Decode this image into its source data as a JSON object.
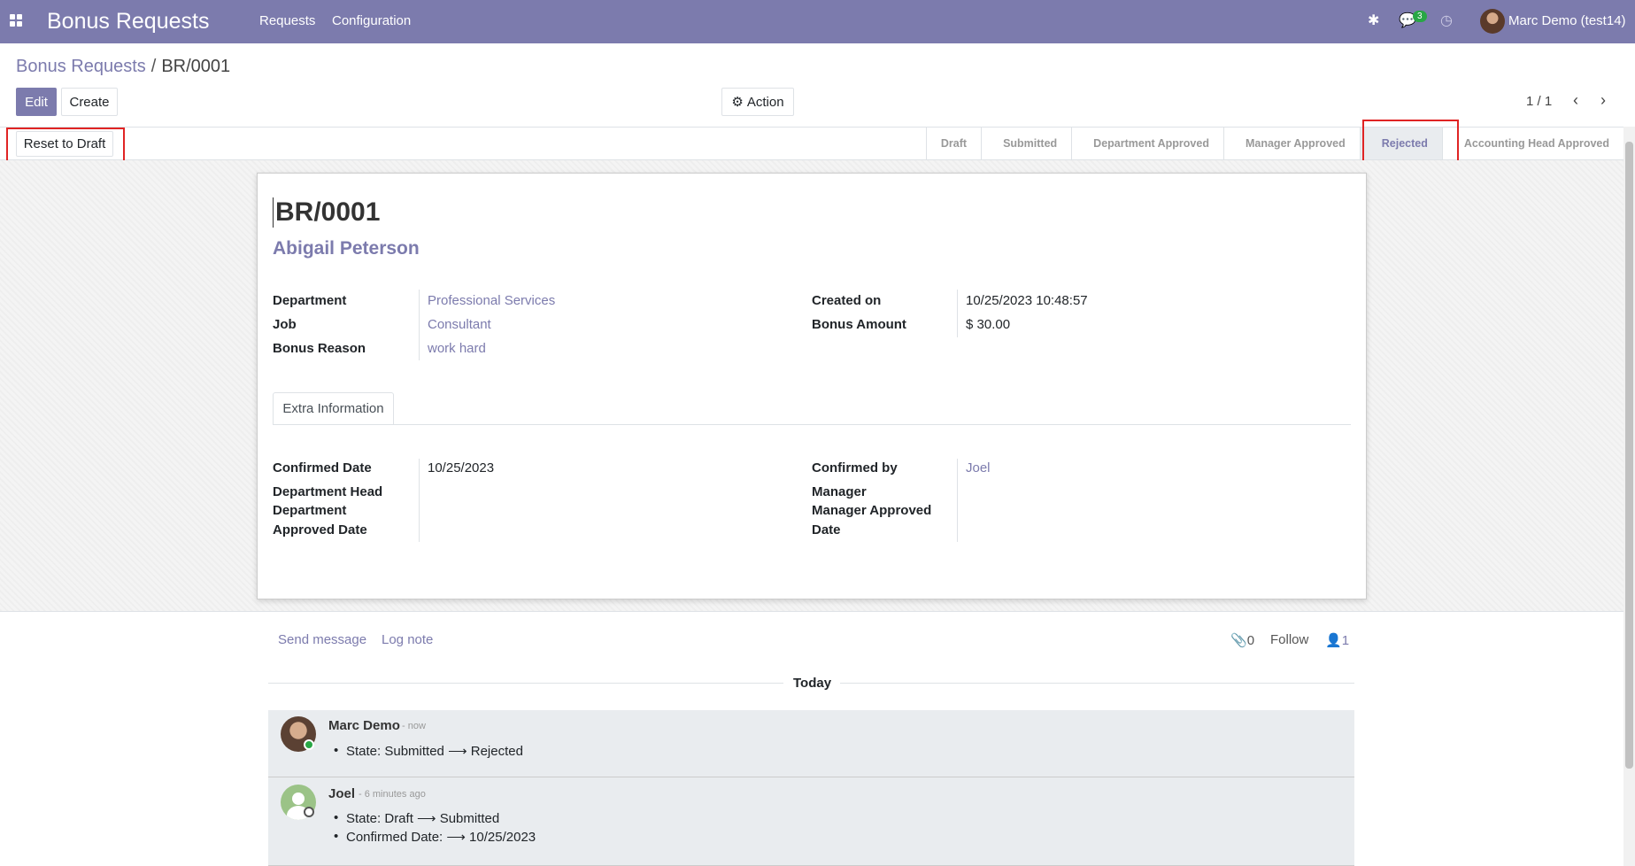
{
  "navbar": {
    "app_title": "Bonus Requests",
    "menu": [
      "Requests",
      "Configuration"
    ],
    "message_count": "3",
    "user": "Marc Demo (test14)"
  },
  "breadcrumb": {
    "parent": "Bonus Requests",
    "separator": "/",
    "current": "BR/0001"
  },
  "buttons": {
    "edit": "Edit",
    "create": "Create",
    "action": "Action",
    "reset": "Reset to Draft"
  },
  "pager": {
    "value": "1 / 1"
  },
  "statusbar": {
    "stages": [
      "Draft",
      "Submitted",
      "Department Approved",
      "Manager Approved",
      "Rejected",
      "Accounting Head Approved"
    ],
    "active": "Rejected"
  },
  "record": {
    "name": "BR/0001",
    "employee": "Abigail Peterson",
    "labels": {
      "department": "Department",
      "job": "Job",
      "bonus_reason": "Bonus Reason",
      "created_on": "Created on",
      "bonus_amount": "Bonus Amount"
    },
    "values": {
      "department": "Professional Services",
      "job": "Consultant",
      "bonus_reason": "work hard",
      "created_on": "10/25/2023 10:48:57",
      "bonus_amount": "$ 30.00"
    }
  },
  "tabs": [
    "Extra Information"
  ],
  "extra": {
    "labels": {
      "confirmed_date": "Confirmed Date",
      "dept_head_approved_date": [
        "Department Head",
        "Department",
        "Approved Date"
      ],
      "confirmed_by": "Confirmed by",
      "manager_approved_date": [
        "Manager",
        "Manager Approved",
        "Date"
      ]
    },
    "values": {
      "confirmed_date": "10/25/2023",
      "confirmed_by": "Joel"
    }
  },
  "chatter": {
    "send_message": "Send message",
    "log_note": "Log note",
    "attachments": "0",
    "follow": "Follow",
    "followers": "1",
    "day": "Today",
    "messages": [
      {
        "author": "Marc Demo",
        "time": "- now",
        "lines": [
          "State: Submitted ⟶ Rejected"
        ]
      },
      {
        "author": "Joel",
        "time": "- 6 minutes ago",
        "lines": [
          "State: Draft ⟶ Submitted",
          "Confirmed Date: ⟶ 10/25/2023"
        ]
      }
    ]
  },
  "colors": {
    "brand": "#7c7bad",
    "highlight": "#e02424"
  }
}
